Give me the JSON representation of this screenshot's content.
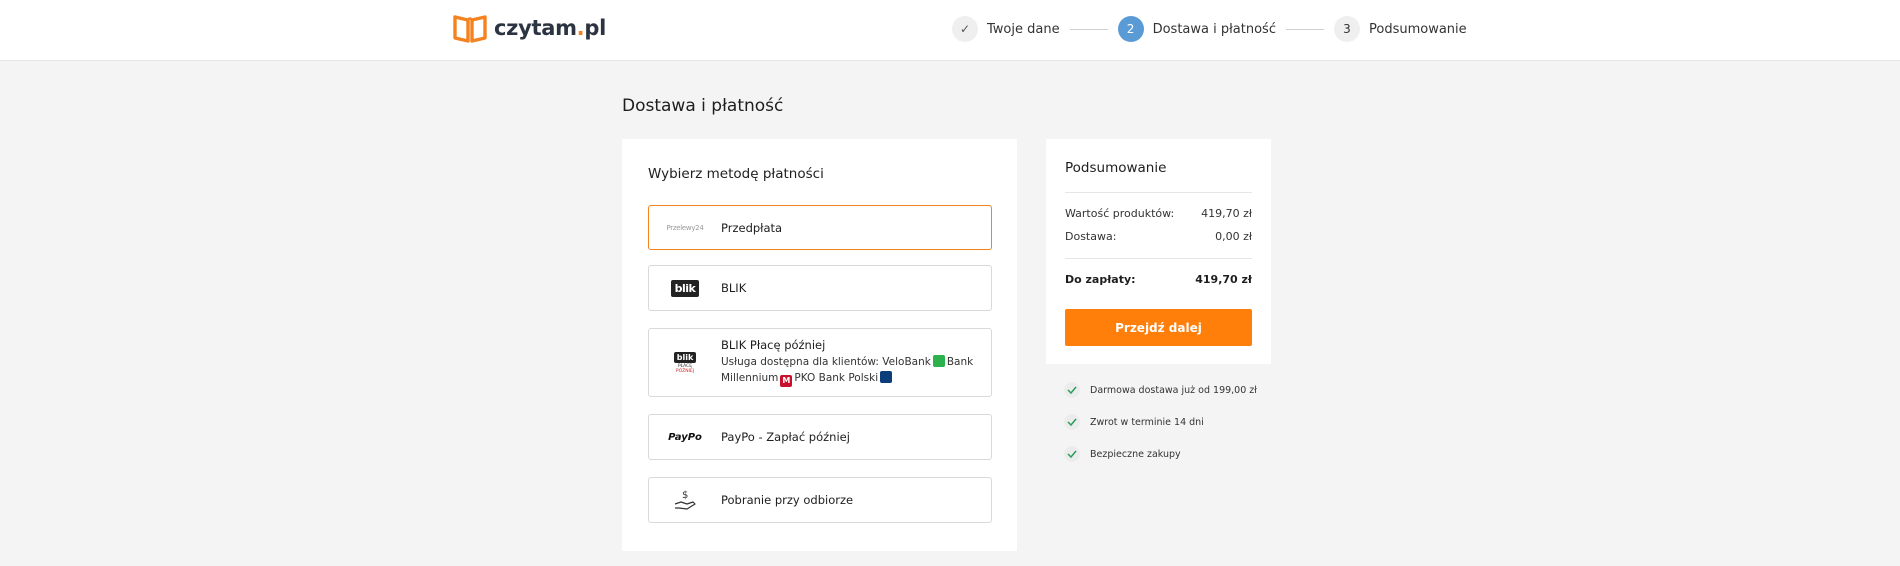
{
  "header": {
    "logo_text": "czytam",
    "logo_dot": ".",
    "logo_tld": "pl",
    "steps": [
      {
        "number": "✓",
        "label": "Twoje dane",
        "state": "done"
      },
      {
        "number": "2",
        "label": "Dostawa i płatność",
        "state": "active"
      },
      {
        "number": "3",
        "label": "Podsumowanie",
        "state": "todo"
      }
    ]
  },
  "page_title": "Dostawa i płatność",
  "payment": {
    "title": "Wybierz metodę płatności",
    "options": [
      {
        "label": "Przedpłata",
        "logo": "Przelewy24",
        "logo_suffix": "24",
        "icon": "przelewy24-logo",
        "selected": true
      },
      {
        "label": "BLIK",
        "logo": "blik",
        "icon": "blik-logo"
      },
      {
        "label": "BLIK Płacę później",
        "logo": "blik",
        "logo_sub1": "PŁACĘ",
        "logo_sub2": "PÓŹNIEJ",
        "icon": "blik-later-logo",
        "desc_1": "Usługa dostępna dla klientów: VeloBank",
        "desc_2": "Bank",
        "desc_3": "Millennium",
        "desc_4": "PKO Bank Polski"
      },
      {
        "label": "PayPo - Zapłać później",
        "logo": "PayPo",
        "icon": "paypo-logo"
      },
      {
        "label": "Pobranie przy odbiorze",
        "logo": "$",
        "icon": "hand-money-icon"
      }
    ]
  },
  "summary": {
    "title": "Podsumowanie",
    "products_label": "Wartość produktów:",
    "products_value": "419,70 zł",
    "delivery_label": "Dostawa:",
    "delivery_value": "0,00 zł",
    "total_label": "Do zapłaty:",
    "total_value": "419,70 zł",
    "cta_label": "Przejdź dalej"
  },
  "benefits": [
    "Darmowa dostawa już od 199,00 zł",
    "Zwrot w terminie 14 dni",
    "Bezpieczne zakupy"
  ],
  "colors": {
    "accent": "#ff7f0a",
    "active_step": "#5b9bd5",
    "selected_border": "#f5821f",
    "check": "#2a9d5c"
  }
}
